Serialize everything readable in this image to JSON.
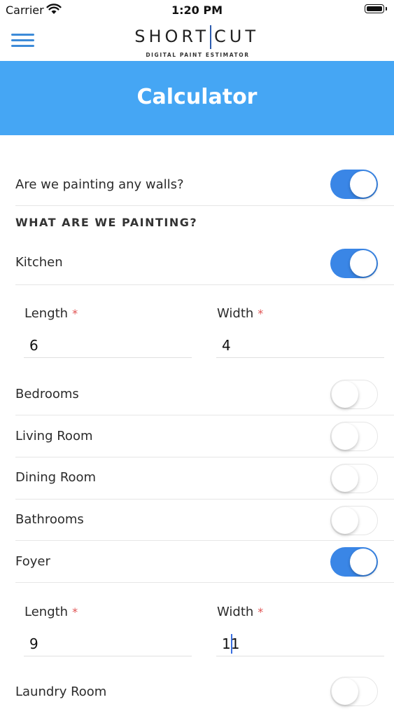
{
  "status": {
    "carrier": "Carrier",
    "time": "1:20 PM"
  },
  "header": {
    "logo_left": "SHORT",
    "logo_right": "CUT",
    "logo_sub": "DIGITAL PAINT ESTIMATOR"
  },
  "page": {
    "title": "Calculator"
  },
  "walls_question": {
    "label": "Are we painting any walls?",
    "on": true
  },
  "section_heading": "WHAT ARE WE PAINTING?",
  "rooms": [
    {
      "label": "Kitchen",
      "on": true,
      "length_label": "Length",
      "length_value": "6",
      "width_label": "Width",
      "width_value": "4"
    },
    {
      "label": "Bedrooms",
      "on": false
    },
    {
      "label": "Living Room",
      "on": false
    },
    {
      "label": "Dining Room",
      "on": false
    },
    {
      "label": "Bathrooms",
      "on": false
    },
    {
      "label": "Foyer",
      "on": true,
      "length_label": "Length",
      "length_value": "9",
      "width_label": "Width",
      "width_value": "11"
    },
    {
      "label": "Laundry Room",
      "on": false
    }
  ],
  "required_mark": "*",
  "colors": {
    "accent": "#45a6f4",
    "toggle_on": "#3a86e6",
    "required": "#e05252",
    "menu": "#3d8bd8"
  }
}
